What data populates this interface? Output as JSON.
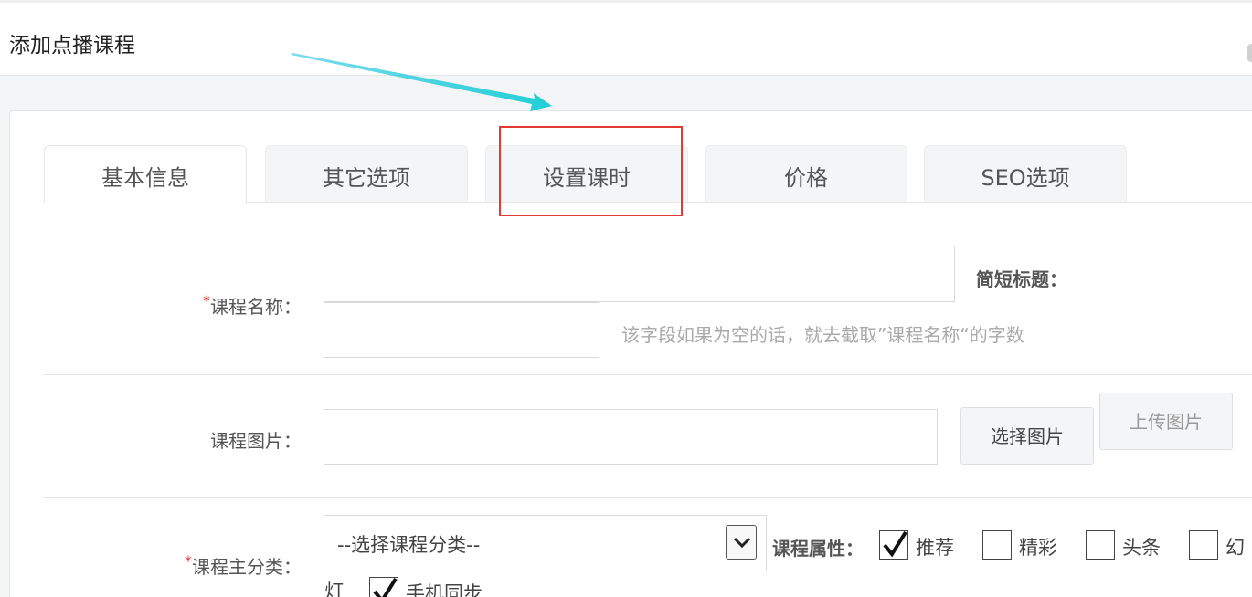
{
  "header": {
    "title": "添加点播课程"
  },
  "tabs": [
    {
      "label": "基本信息",
      "active": true
    },
    {
      "label": "其它选项",
      "active": false
    },
    {
      "label": "设置课时",
      "active": false,
      "highlighted": true
    },
    {
      "label": "价格",
      "active": false
    },
    {
      "label": "SEO选项",
      "active": false
    }
  ],
  "form": {
    "course_name": {
      "required_mark": "*",
      "label": "课程名称：",
      "value": "",
      "short_title_label": "简短标题：",
      "short_title_value": "",
      "short_title_hint": "该字段如果为空的话，就去截取”课程名称“的字数"
    },
    "course_image": {
      "label": "课程图片：",
      "value": "",
      "select_button": "选择图片",
      "upload_button": "上传图片"
    },
    "main_category": {
      "required_mark": "*",
      "label": "课程主分类：",
      "selected": "--选择课程分类--",
      "attributes_label": "课程属性：",
      "attributes": [
        {
          "label": "推荐",
          "checked": true
        },
        {
          "label": "精彩",
          "checked": false
        },
        {
          "label": "头条",
          "checked": false
        },
        {
          "label": "幻灯",
          "checked": false
        },
        {
          "label": "手机同步",
          "checked": true
        }
      ]
    }
  },
  "colors": {
    "highlight": "#e53935",
    "arrow": "#1fd1d6",
    "required": "#e53935"
  }
}
